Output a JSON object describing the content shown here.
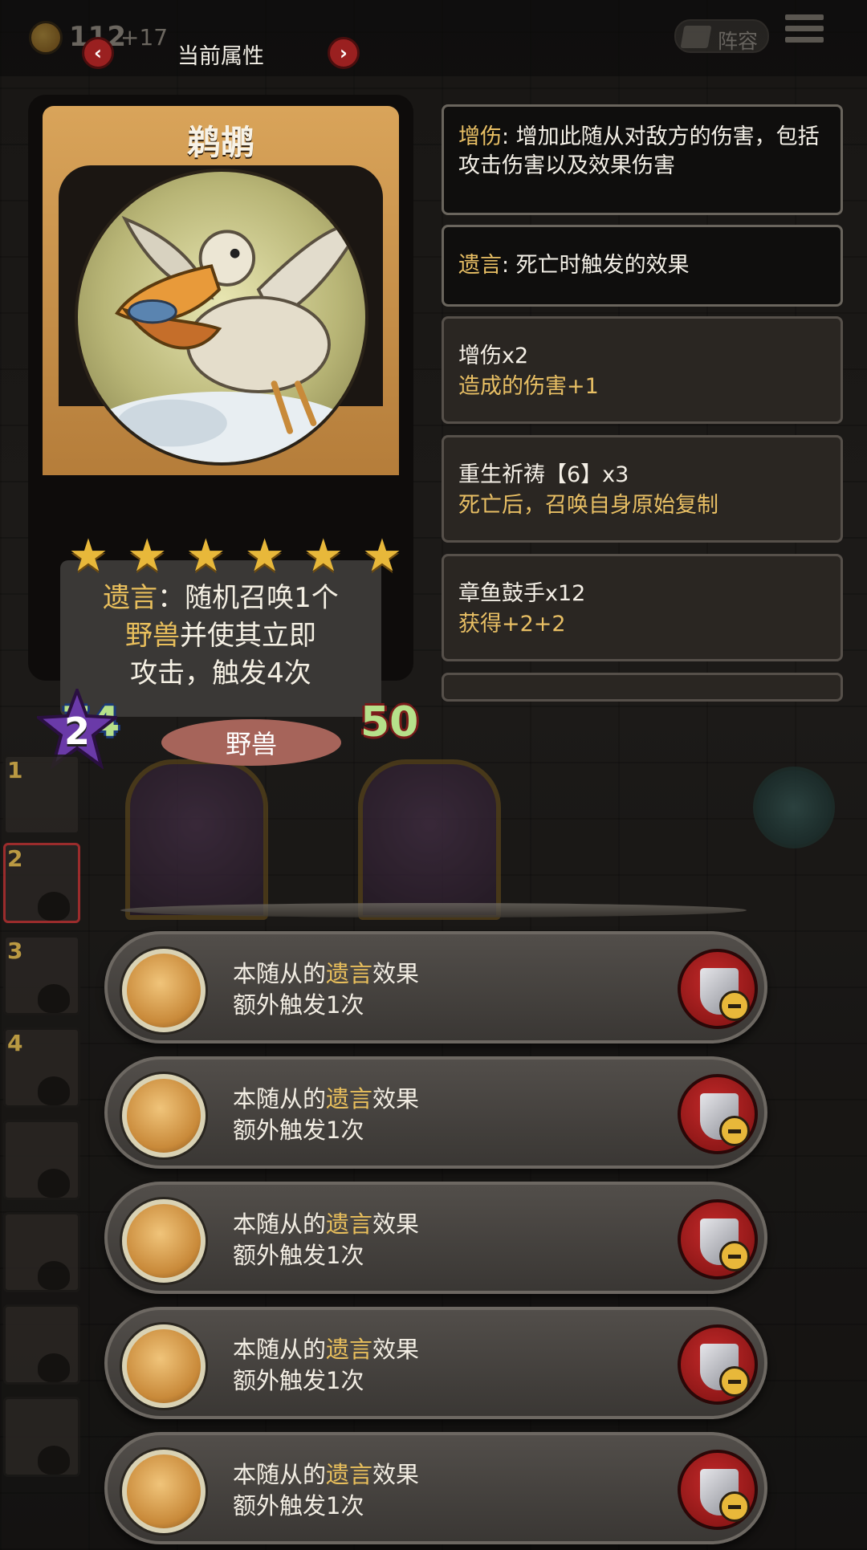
{
  "topbar": {
    "coins": "112",
    "coin_delta": "+17",
    "title": "当前属性",
    "prev_label": "‹",
    "next_label": "›",
    "lineup_label": "阵容"
  },
  "card": {
    "name": "鹈鹕",
    "stars": 6,
    "desc_line1_key": "遗言",
    "desc_line1_rest": "：随机召唤1个",
    "desc_line2_key": "野兽",
    "desc_line2_rest": "并使其立即",
    "desc_line3": "攻击，触发4次",
    "attack": "74",
    "health": "50",
    "tribe": "野兽"
  },
  "keywords": [
    {
      "key": "增伤",
      "text": ": 增加此随从对敌方的伤害，包括攻击伤害以及效果伤害"
    },
    {
      "key": "遗言",
      "text": ": 死亡时触发的效果"
    }
  ],
  "buffs": [
    {
      "title": "增伤x2",
      "desc": "造成的伤害+1"
    },
    {
      "title": "重生祈祷【6】x3",
      "desc": "死亡后，召唤自身原始复制"
    },
    {
      "title": "章鱼鼓手x12",
      "desc": "获得+2+2"
    }
  ],
  "level": "2",
  "roster": [
    "1",
    "2",
    "3",
    "4"
  ],
  "effects": [
    {
      "pre": "本随从的",
      "key": "遗言",
      "post": "效果",
      "line2": "额外触发1次"
    },
    {
      "pre": "本随从的",
      "key": "遗言",
      "post": "效果",
      "line2": "额外触发1次"
    },
    {
      "pre": "本随从的",
      "key": "遗言",
      "post": "效果",
      "line2": "额外触发1次"
    },
    {
      "pre": "本随从的",
      "key": "遗言",
      "post": "效果",
      "line2": "额外触发1次"
    },
    {
      "pre": "本随从的",
      "key": "遗言",
      "post": "效果",
      "line2": "额外触发1次"
    }
  ],
  "icons": {
    "coin": "coin-icon",
    "menu": "menu-icon",
    "remove": "shield-minus-icon",
    "medal": "skull-medal-icon",
    "star": "star-icon"
  },
  "colors": {
    "keyword": "#e8bf64",
    "stat_green": "#b6e08a",
    "remove_red": "#c42a2a"
  }
}
